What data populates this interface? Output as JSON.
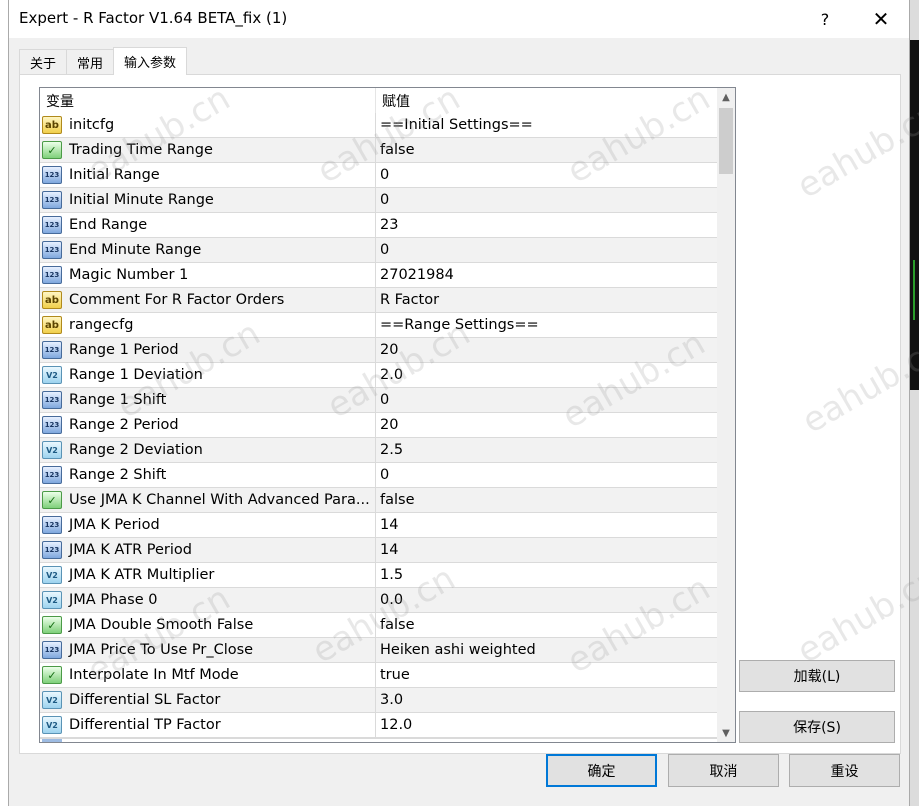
{
  "window": {
    "title": "Expert - R Factor V1.64 BETA_fix (1)",
    "help_glyph": "?",
    "close_glyph": "✕"
  },
  "tabs": [
    {
      "label": "关于",
      "active": false
    },
    {
      "label": "常用",
      "active": false
    },
    {
      "label": "输入参数",
      "active": true
    }
  ],
  "grid": {
    "col_variable": "变量",
    "col_value": "赋值",
    "rows": [
      {
        "type": "ab",
        "name": "initcfg",
        "value": "==Initial Settings=="
      },
      {
        "type": "bool",
        "name": "Trading Time Range",
        "value": "false"
      },
      {
        "type": "num",
        "name": "Initial Range",
        "value": "0"
      },
      {
        "type": "num",
        "name": "Initial Minute Range",
        "value": "0"
      },
      {
        "type": "num",
        "name": "End Range",
        "value": "23"
      },
      {
        "type": "num",
        "name": "End Minute Range",
        "value": "0"
      },
      {
        "type": "num",
        "name": "Magic Number 1",
        "value": "27021984"
      },
      {
        "type": "ab",
        "name": "Comment For R Factor Orders",
        "value": "R Factor"
      },
      {
        "type": "ab",
        "name": "rangecfg",
        "value": "==Range Settings=="
      },
      {
        "type": "num",
        "name": "Range 1 Period",
        "value": "20"
      },
      {
        "type": "dbl",
        "name": "Range 1 Deviation",
        "value": "2.0"
      },
      {
        "type": "num",
        "name": "Range 1 Shift",
        "value": "0"
      },
      {
        "type": "num",
        "name": "Range 2 Period",
        "value": "20"
      },
      {
        "type": "dbl",
        "name": "Range 2 Deviation",
        "value": "2.5"
      },
      {
        "type": "num",
        "name": "Range 2 Shift",
        "value": "0"
      },
      {
        "type": "bool",
        "name": "Use JMA K Channel With Advanced Para...",
        "value": "false"
      },
      {
        "type": "num",
        "name": "JMA K Period",
        "value": "14"
      },
      {
        "type": "num",
        "name": "JMA K ATR Period",
        "value": "14"
      },
      {
        "type": "dbl",
        "name": "JMA K ATR Multiplier",
        "value": "1.5"
      },
      {
        "type": "dbl",
        "name": "JMA Phase 0",
        "value": "0.0"
      },
      {
        "type": "bool",
        "name": "JMA Double Smooth False",
        "value": "false"
      },
      {
        "type": "num",
        "name": "JMA Price To Use Pr_Close",
        "value": "Heiken ashi weighted"
      },
      {
        "type": "bool",
        "name": "Interpolate In Mtf Mode",
        "value": "true"
      },
      {
        "type": "dbl",
        "name": "Differential SL Factor",
        "value": "3.0"
      },
      {
        "type": "dbl",
        "name": "Differential TP Factor",
        "value": "12.0"
      }
    ]
  },
  "icon_glyphs": {
    "ab": "ab",
    "num": "123",
    "dbl": "V2",
    "bool": "✓"
  },
  "icon_names": {
    "ab": "string-type-icon",
    "num": "integer-type-icon",
    "dbl": "double-type-icon",
    "bool": "boolean-type-icon"
  },
  "side_buttons": {
    "load": "加载(L)",
    "save": "保存(S)"
  },
  "footer_buttons": {
    "ok": "确定",
    "cancel": "取消",
    "reset": "重设"
  },
  "watermark_text": "eahub.cn"
}
